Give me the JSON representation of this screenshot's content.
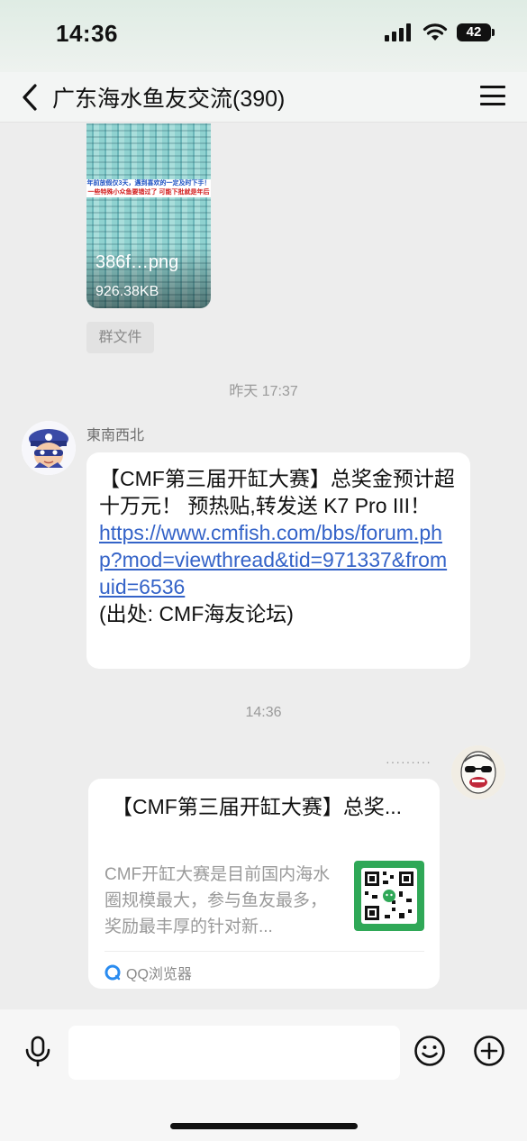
{
  "status_bar": {
    "time": "14:36",
    "battery": "42"
  },
  "nav": {
    "title": "广东海水鱼友交流(390)"
  },
  "image_message": {
    "banner_line1": "年前放假仅3天，遇到喜欢的一定及时下手！",
    "banner_line2": "一些特殊小众鱼要错过了 可能下批就是年后",
    "file_name": "386f…png",
    "file_size": "926.38KB"
  },
  "group_file_tag": "群文件",
  "timestamp_1": "昨天 17:37",
  "message_1": {
    "sender": "東南西北",
    "text": "【CMF第三届开缸大赛】总奖金预计超十万元！ 预热贴,转发送 K7 Pro III！",
    "link": "https://www.cmfish.com/bbs/forum.php?mod=viewthread&tid=971337&fromuid=6536",
    "source": "(出处: CMF海友论坛)"
  },
  "timestamp_2": "14:36",
  "message_2": {
    "pending": "·········",
    "card_title": "【CMF第三届开缸大赛】总奖...",
    "card_desc": "CMF开缸大赛是目前国内海水圈规模最大，参与鱼友最多，奖励最丰厚的针对新...",
    "card_source": "QQ浏览器"
  },
  "colors": {
    "link": "#3463c8",
    "qr_bg": "#2fa857",
    "background": "#ededed"
  }
}
